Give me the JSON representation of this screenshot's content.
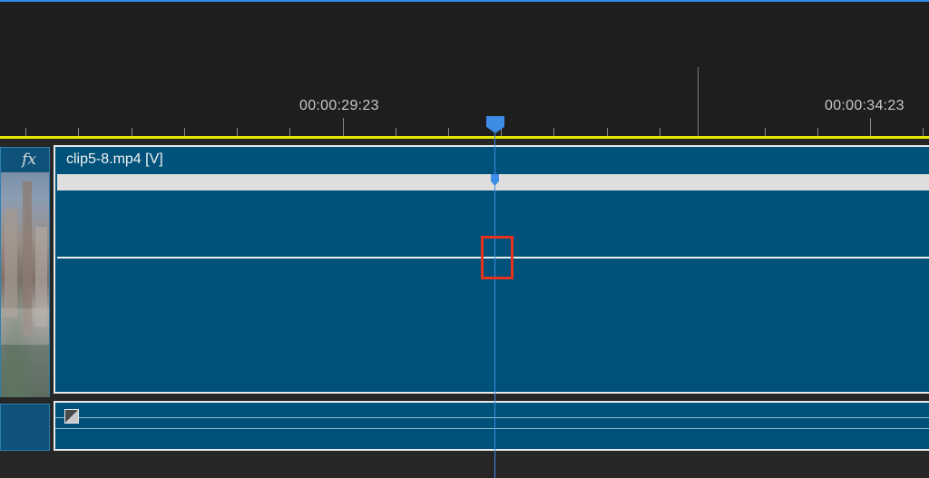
{
  "timeline": {
    "ruler": {
      "timecode_1": "00:00:29:23",
      "timecode_2": "00:00:34:23"
    },
    "video_track": {
      "fx_label": "fx",
      "clip_name": "clip5-8.mp4 [V]"
    },
    "colors": {
      "clip_fill": "#01527a",
      "playhead": "#3d8ce6",
      "work_area": "#e6e600",
      "highlight": "#e8321d",
      "accent": "#2d8ceb"
    },
    "icons": [
      "playhead-icon",
      "keyframe-marker-icon",
      "audio-keyframe-icon",
      "fx-icon"
    ]
  }
}
